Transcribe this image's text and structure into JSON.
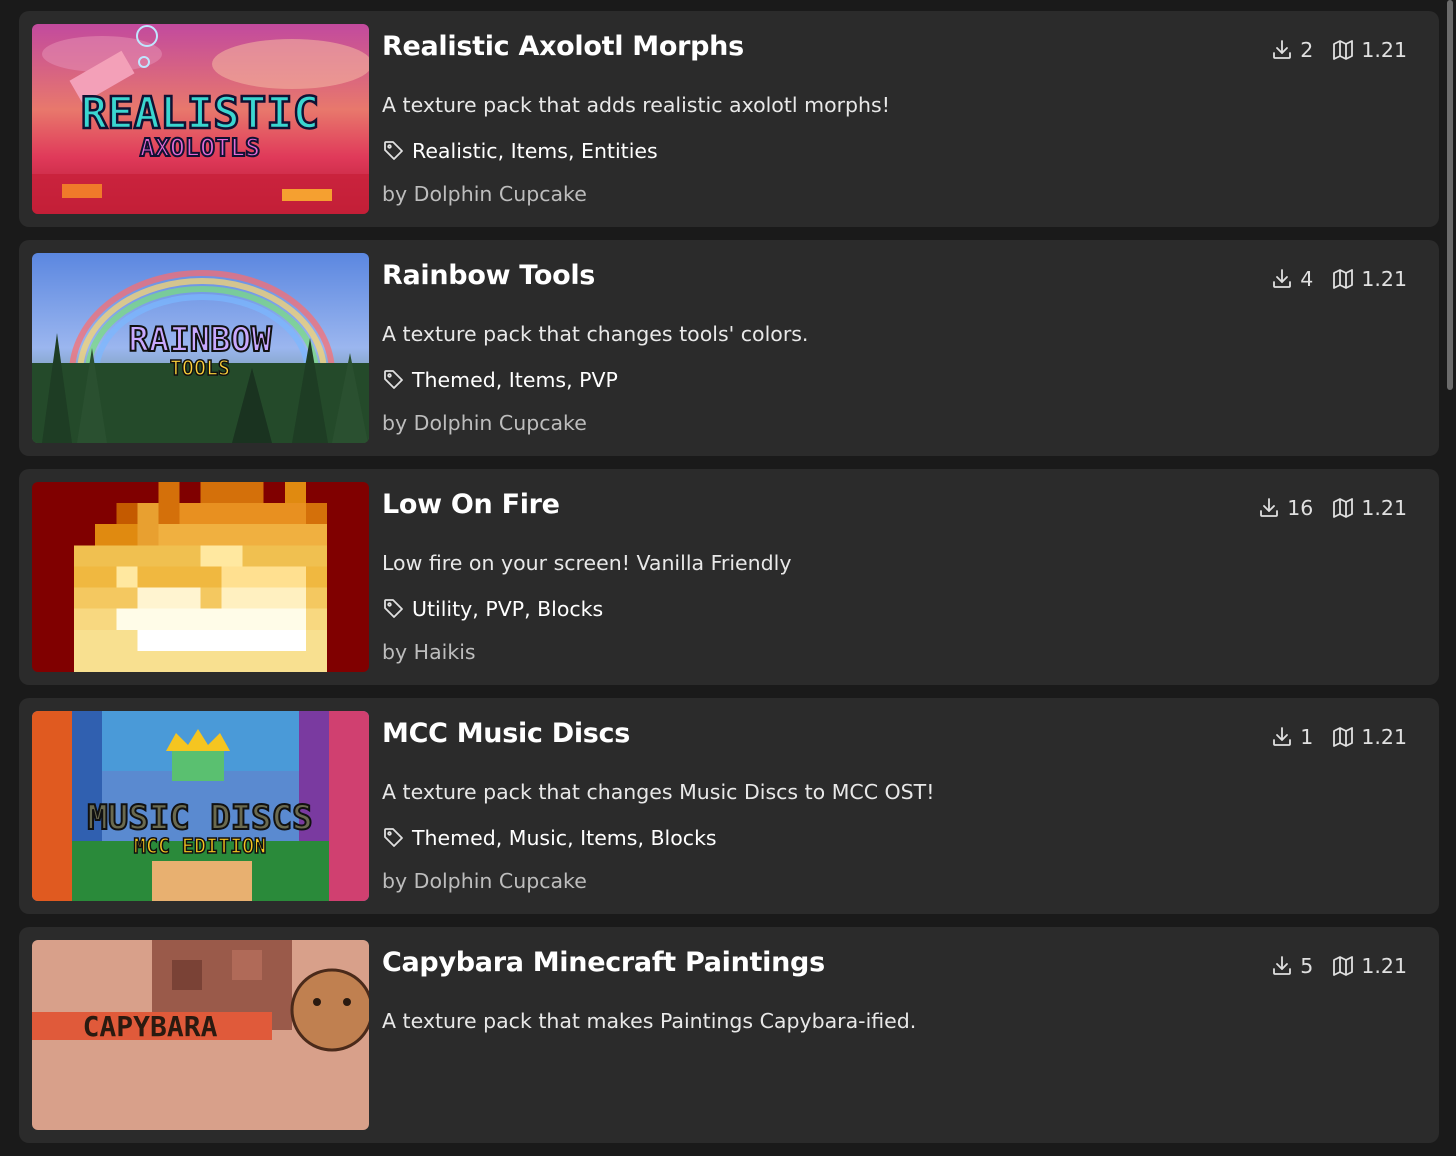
{
  "packs": [
    {
      "title": "Realistic Axolotl Morphs",
      "downloads": "2",
      "version": "1.21",
      "description": "A texture pack that adds realistic axolotl morphs!",
      "tags": "Realistic, Items, Entities",
      "author": "by Dolphin Cupcake",
      "thumb_text_1": "REALISTIC",
      "thumb_text_2": "AXOLOTLS"
    },
    {
      "title": "Rainbow Tools",
      "downloads": "4",
      "version": "1.21",
      "description": "A texture pack that changes tools' colors.",
      "tags": "Themed, Items, PVP",
      "author": "by Dolphin Cupcake",
      "thumb_text_1": "RAINBOW",
      "thumb_text_2": "TOOLS"
    },
    {
      "title": "Low On Fire",
      "downloads": "16",
      "version": "1.21",
      "description": "Low fire on your screen! Vanilla Friendly",
      "tags": "Utility, PVP, Blocks",
      "author": "by Haikis"
    },
    {
      "title": "MCC Music Discs",
      "downloads": "1",
      "version": "1.21",
      "description": "A texture pack that changes Music Discs to MCC OST!",
      "tags": "Themed, Music, Items, Blocks",
      "author": "by Dolphin Cupcake",
      "thumb_text_1": "MUSIC DISCS",
      "thumb_text_2": "MCC EDITION"
    },
    {
      "title": "Capybara Minecraft Paintings",
      "downloads": "5",
      "version": "1.21",
      "description": "A texture pack that makes Paintings Capybara-ified.",
      "tags": "",
      "author": "",
      "thumb_text_1": "CAPYBARA"
    }
  ],
  "icons": {
    "download": "download-icon",
    "version": "map-icon",
    "tag": "tag-icon"
  },
  "colors": {
    "page_bg": "#1a1a1a",
    "card_bg": "#2b2b2b",
    "author": "#bdbdbd"
  }
}
